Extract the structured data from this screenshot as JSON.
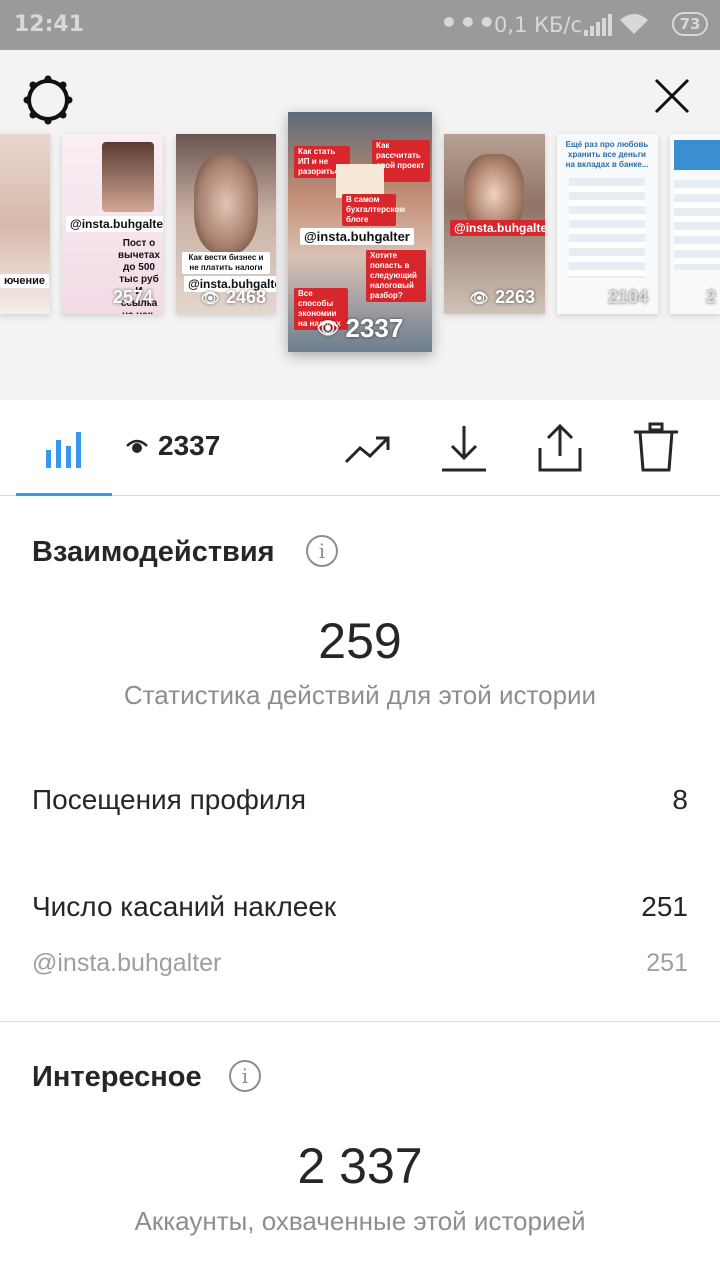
{
  "status_bar": {
    "time": "12:41",
    "dots": "•••",
    "network_speed": "0,1 КБ/с",
    "battery": "73"
  },
  "stories": [
    {
      "views": "",
      "caption": "ючение"
    },
    {
      "views": "2574",
      "caption": "@insta.buhgalter",
      "text": "Пост о вычетах до 500 тыс руб И ссылка на чек-лист"
    },
    {
      "views": "2468",
      "caption": "@insta.buhgalter",
      "text": "Как вести бизнес и не платить налоги"
    },
    {
      "views": "2337",
      "caption": "@insta.buhgalter",
      "texts": [
        "Как стать ИП и не разориться",
        "Как рассчитать свой проект ?",
        "В самом бухгалтерском блоге",
        "Хотите попасть в следующий налоговый разбор?",
        "Все способы экономии на налогах"
      ]
    },
    {
      "views": "2263",
      "caption": "@insta.buhgalter"
    },
    {
      "views": "2104",
      "caption": "Ещё раз про любовь хранить все деньги на вкладах в банке..."
    },
    {
      "views": "2",
      "caption": ""
    }
  ],
  "toolbar": {
    "views": "2337"
  },
  "interactions": {
    "title": "Взаимодействия",
    "info": "i",
    "total": "259",
    "caption": "Статистика действий для этой истории",
    "rows": [
      {
        "label": "Посещения профиля",
        "value": "8"
      },
      {
        "label": "Число касаний наклеек",
        "value": "251"
      }
    ],
    "sub_row": {
      "label": "@insta.buhgalter",
      "value": "251"
    }
  },
  "discovery": {
    "title": "Интересное",
    "info": "i",
    "total": "2 337",
    "caption": "Аккаунты, охваченные этой историей"
  },
  "colors": {
    "accent": "#3897f0",
    "text": "#262626",
    "muted": "#8e8e8e",
    "tag_red": "#d8262d"
  }
}
